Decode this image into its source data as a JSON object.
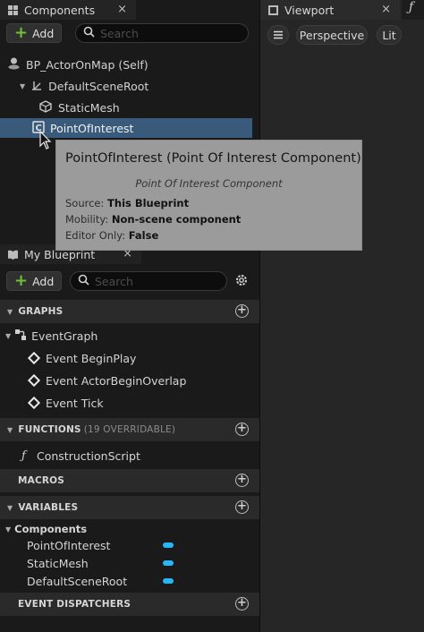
{
  "components_panel": {
    "tab_label": "Components",
    "close_glyph": "×",
    "add_label": "Add",
    "search_placeholder": "Search",
    "tree": [
      {
        "label": "BP_ActorOnMap (Self)",
        "icon": "actor-icon"
      },
      {
        "label": "DefaultSceneRoot",
        "icon": "scene-root-icon"
      },
      {
        "label": "StaticMesh",
        "icon": "static-mesh-icon"
      },
      {
        "label": "PointOfInterest",
        "icon": "component-icon",
        "selected": true
      }
    ]
  },
  "tooltip": {
    "title": "PointOfInterest (Point Of Interest Component)",
    "description": "Point Of Interest Component",
    "rows": [
      {
        "key": "Source:",
        "value": "This Blueprint"
      },
      {
        "key": "Mobility:",
        "value": "Non-scene component"
      },
      {
        "key": "Editor Only:",
        "value": "False"
      }
    ]
  },
  "viewport": {
    "tab_label": "Viewport",
    "close_glyph": "×",
    "perspective_label": "Perspective",
    "lit_label": "Lit"
  },
  "my_blueprint": {
    "tab_label": "My Blueprint",
    "close_glyph": "×",
    "add_label": "Add",
    "search_placeholder": "Search",
    "sections": {
      "graphs": "GRAPHS",
      "functions": "FUNCTIONS",
      "functions_sub": "(19 OVERRIDABLE)",
      "macros": "MACROS",
      "variables": "VARIABLES",
      "event_dispatchers": "EVENT DISPATCHERS"
    },
    "event_graph": "EventGraph",
    "events": [
      "Event BeginPlay",
      "Event ActorBeginOverlap",
      "Event Tick"
    ],
    "construction_script": "ConstructionScript",
    "components_category": "Components",
    "variables": [
      "PointOfInterest",
      "StaticMesh",
      "DefaultSceneRoot"
    ]
  },
  "colors": {
    "selection": "#3a5a7c",
    "add_plus": "#6fbf3a",
    "variable_pill": "#29b6f6",
    "tooltip_bg": "#9b9b9b"
  }
}
